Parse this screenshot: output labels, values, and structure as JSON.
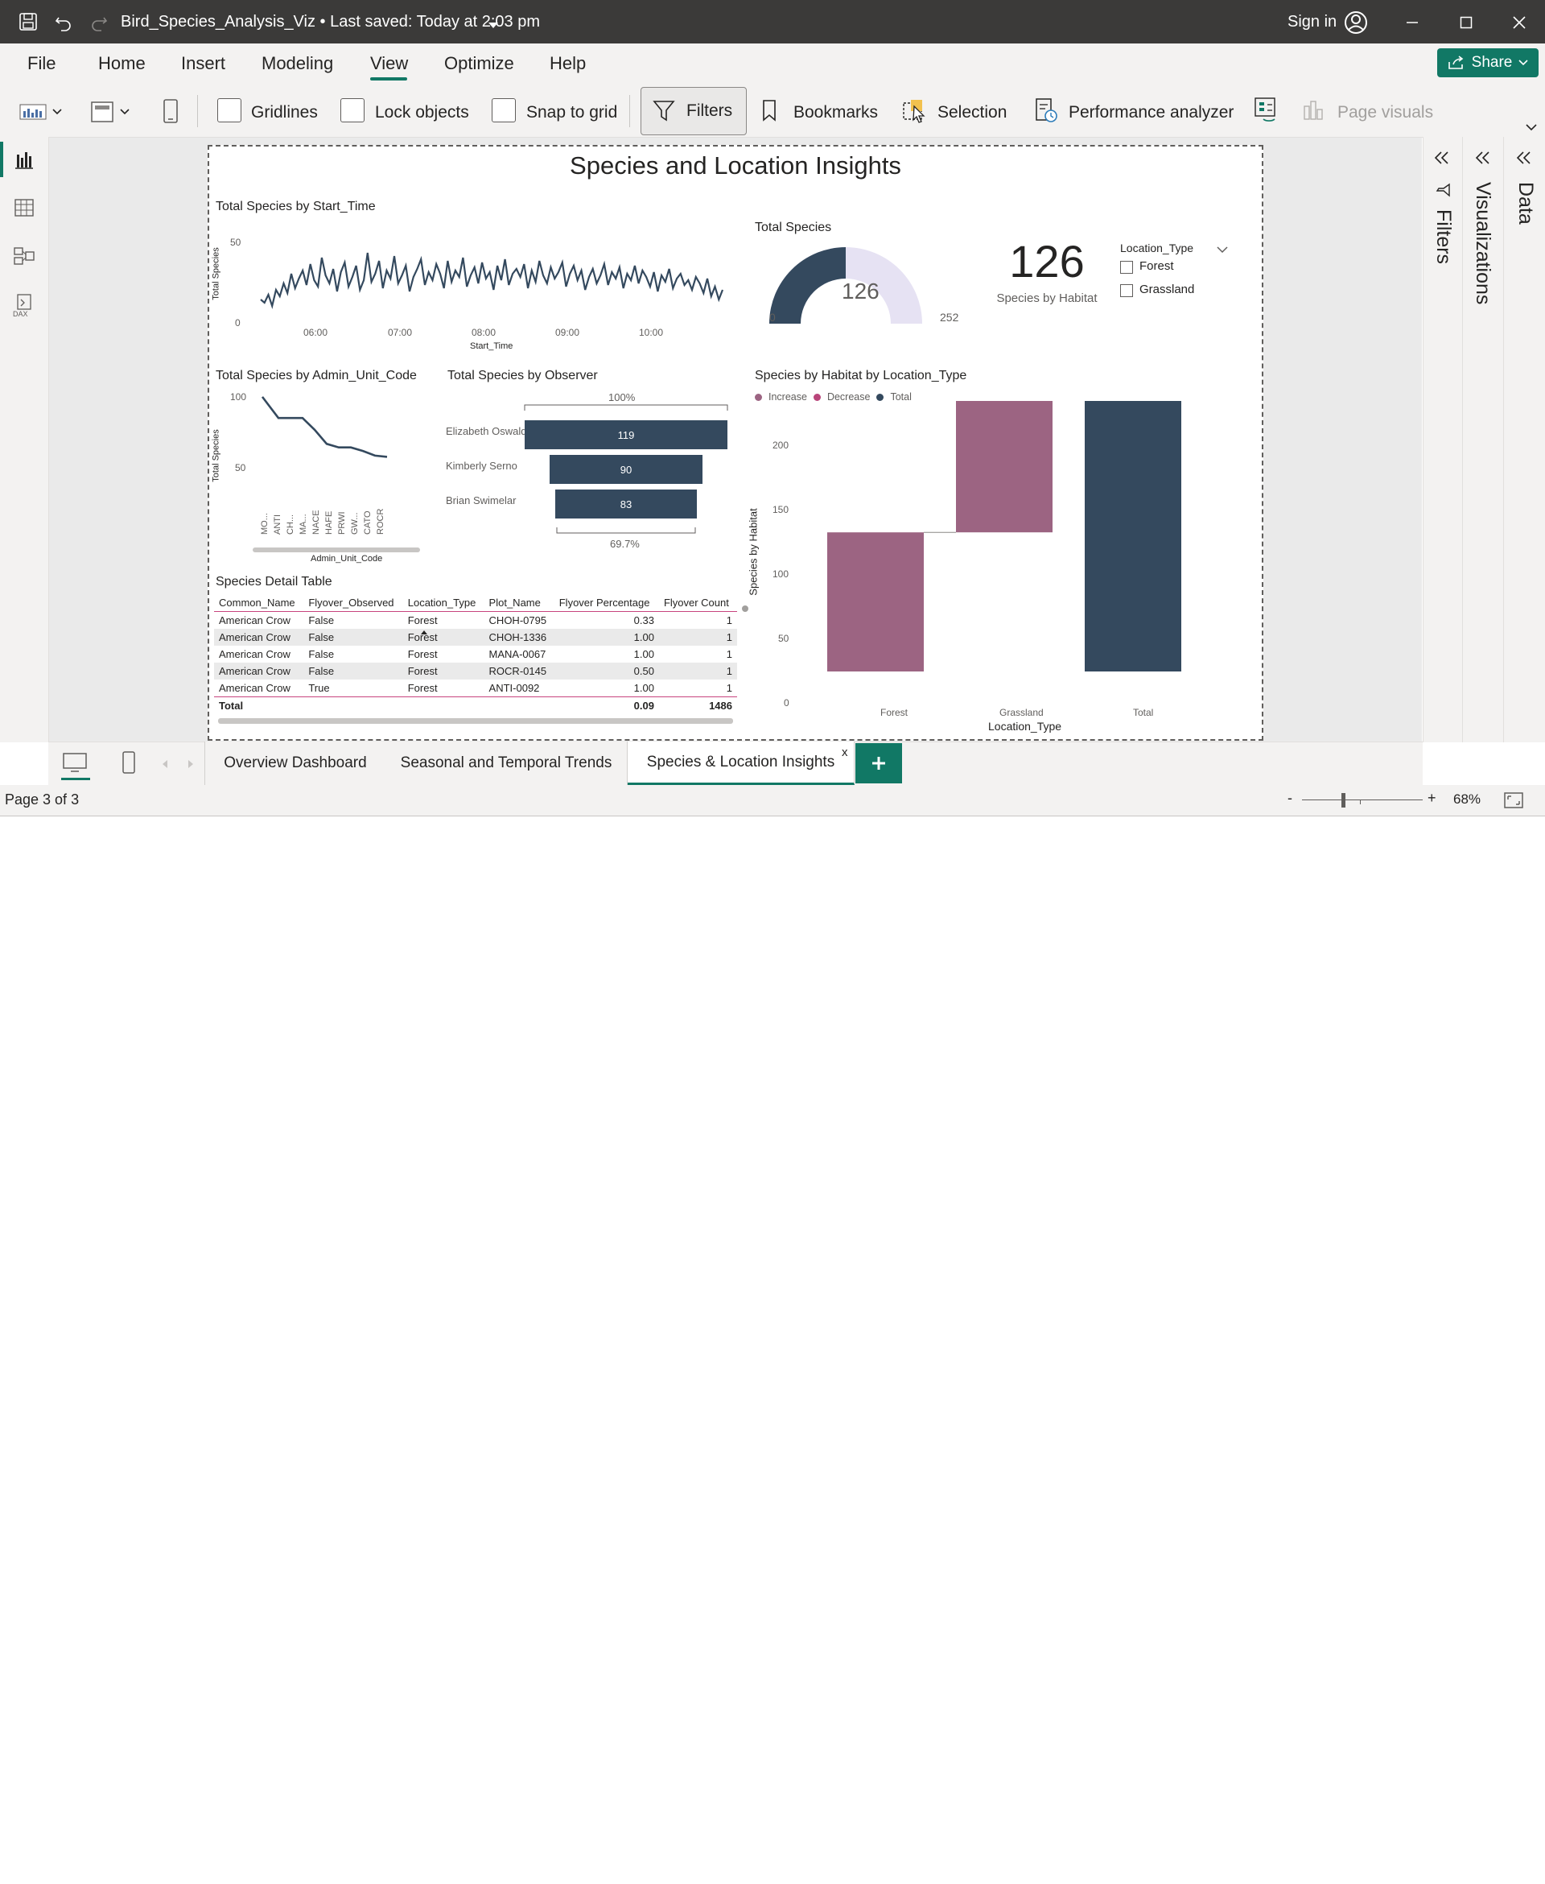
{
  "titlebar": {
    "title": "Bird_Species_Analysis_Viz • Last saved: Today at 2:03 pm",
    "sign_in": "Sign in"
  },
  "menu": [
    "File",
    "Home",
    "Insert",
    "Modeling",
    "View",
    "Optimize",
    "Help"
  ],
  "active_menu": "View",
  "share_label": "Share",
  "ribbon": {
    "gridlines": "Gridlines",
    "lock_objects": "Lock objects",
    "snap_to_grid": "Snap to grid",
    "filters": "Filters",
    "bookmarks": "Bookmarks",
    "selection": "Selection",
    "performance_analyzer": "Performance analyzer",
    "page_visuals": "Page visuals"
  },
  "panes": {
    "filters": "Filters",
    "visualizations": "Visualizations",
    "data": "Data"
  },
  "report": {
    "title": "Species and Location Insights",
    "line1": {
      "title": "Total Species by Start_Time",
      "ylabel": "Total Species",
      "xlabel": "Start_Time",
      "yticks": [
        "50",
        "0"
      ],
      "xticks": [
        "06:00",
        "07:00",
        "08:00",
        "09:00",
        "10:00"
      ]
    },
    "gauge": {
      "title": "Total Species",
      "value": "126",
      "min": "0",
      "max": "252",
      "value_num": 126,
      "max_num": 252
    },
    "card": {
      "value": "126",
      "label": "Species by Habitat"
    },
    "slicer": {
      "title": "Location_Type",
      "options": [
        "Forest",
        "Grassland"
      ]
    },
    "line2": {
      "title": "Total Species by Admin_Unit_Code",
      "ylabel": "Total Species",
      "xlabel": "Admin_Unit_Code",
      "yticks": [
        "100",
        "50"
      ],
      "categories": [
        "MO...",
        "ANTI",
        "CH...",
        "MA...",
        "NACE",
        "HAFE",
        "PRWI",
        "GW...",
        "CATO",
        "ROCR"
      ]
    },
    "funnel": {
      "title": "Total Species by Observer",
      "top_label": "100%",
      "bottom_label": "69.7%",
      "rows": [
        {
          "name": "Elizabeth Oswald",
          "value": "119"
        },
        {
          "name": "Kimberly Serno",
          "value": "90"
        },
        {
          "name": "Brian Swimelar",
          "value": "83"
        }
      ]
    },
    "table": {
      "title": "Species Detail Table",
      "headers": [
        "Common_Name",
        "Flyover_Observed",
        "Location_Type",
        "Plot_Name",
        "Flyover Percentage",
        "Flyover Count"
      ],
      "rows": [
        [
          "American Crow",
          "False",
          "Forest",
          "CHOH-0795",
          "0.33",
          "1"
        ],
        [
          "American Crow",
          "False",
          "Forest",
          "CHOH-1336",
          "1.00",
          "1"
        ],
        [
          "American Crow",
          "False",
          "Forest",
          "MANA-0067",
          "1.00",
          "1"
        ],
        [
          "American Crow",
          "False",
          "Forest",
          "ROCR-0145",
          "0.50",
          "1"
        ],
        [
          "American Crow",
          "True",
          "Forest",
          "ANTI-0092",
          "1.00",
          "1"
        ]
      ],
      "total": [
        "Total",
        "",
        "",
        "",
        "0.09",
        "1486"
      ]
    },
    "waterfall": {
      "title": "Species by Habitat by Location_Type",
      "legend": [
        "Increase",
        "Decrease",
        "Total"
      ],
      "ylabel": "Species by Habitat",
      "xlabel": "Location_Type",
      "yticks": [
        "200",
        "150",
        "100",
        "50",
        "0"
      ],
      "categories": [
        "Forest",
        "Grassland",
        "Total"
      ]
    }
  },
  "chart_data": [
    {
      "type": "line",
      "title": "Total Species by Start_Time",
      "xlabel": "Start_Time",
      "ylabel": "Total Species",
      "ylim": [
        0,
        50
      ],
      "x_ticks": [
        "06:00",
        "07:00",
        "08:00",
        "09:00",
        "10:00"
      ],
      "values": [
        12,
        10,
        15,
        8,
        18,
        14,
        22,
        16,
        28,
        19,
        25,
        30,
        21,
        34,
        24,
        20,
        38,
        27,
        22,
        31,
        17,
        29,
        35,
        20,
        26,
        33,
        18,
        24,
        41,
        23,
        28,
        36,
        19,
        30,
        25,
        39,
        22,
        27,
        33,
        17,
        26,
        31,
        37,
        21,
        29,
        24,
        34,
        28,
        19,
        36,
        23,
        30,
        26,
        38,
        20,
        27,
        32,
        22,
        35,
        25,
        29,
        18,
        33,
        24,
        37,
        21,
        28,
        31,
        26,
        34,
        19,
        30,
        23,
        36,
        27,
        22,
        32,
        25,
        29,
        35,
        20,
        28,
        33,
        24,
        30,
        18,
        26,
        31,
        22,
        27,
        34,
        21,
        29,
        25,
        32,
        19,
        28,
        24,
        33,
        22,
        30,
        26,
        20,
        29,
        17,
        27,
        23,
        31,
        19,
        25,
        28,
        21,
        24,
        18,
        26,
        22,
        16,
        25,
        14,
        20,
        12,
        18
      ]
    },
    {
      "type": "gauge",
      "title": "Total Species",
      "value": 126,
      "min": 0,
      "max": 252
    },
    {
      "type": "line",
      "title": "Total Species by Admin_Unit_Code",
      "xlabel": "Admin_Unit_Code",
      "ylabel": "Total Species",
      "categories": [
        "MO...",
        "ANTI",
        "CH...",
        "MA...",
        "NACE",
        "HAFE",
        "PRWI",
        "GW...",
        "CATO",
        "ROCR"
      ],
      "values": [
        98,
        80,
        80,
        80,
        70,
        58,
        55,
        55,
        52,
        48,
        47
      ]
    },
    {
      "type": "bar",
      "title": "Total Species by Observer",
      "categories": [
        "Elizabeth Oswald",
        "Kimberly Serno",
        "Brian Swimelar"
      ],
      "values": [
        119,
        90,
        83
      ]
    },
    {
      "type": "bar",
      "title": "Species by Habitat by Location_Type",
      "xlabel": "Location_Type",
      "ylabel": "Species by Habitat",
      "ylim": [
        0,
        200
      ],
      "categories": [
        "Forest",
        "Grassland",
        "Total"
      ],
      "series": [
        {
          "name": "Increase",
          "values": [
            108,
            106,
            0
          ]
        },
        {
          "name": "Total",
          "values": [
            0,
            0,
            214
          ]
        }
      ],
      "waterfall_ranges": [
        [
          0,
          108
        ],
        [
          108,
          214
        ],
        [
          0,
          214
        ]
      ]
    }
  ],
  "tabs": [
    "Overview Dashboard",
    "Seasonal and Temporal Trends",
    "Species & Location Insights"
  ],
  "active_tab": "Species & Location Insights",
  "status": {
    "page": "Page 3 of 3",
    "zoom": "68%",
    "zoom_minus": "-",
    "zoom_plus": "+"
  },
  "colors": {
    "accent": "#117865",
    "dark_series": "#34495e",
    "waterfall_increase": "#9c6482",
    "decrease": "#b9457a"
  }
}
